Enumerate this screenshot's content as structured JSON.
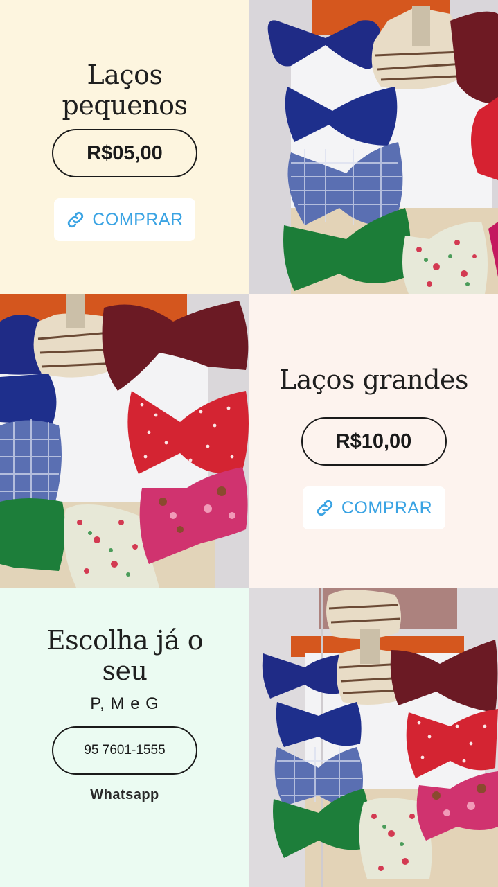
{
  "panels": {
    "small": {
      "title_line1": "Laços",
      "title_line2": "pequenos",
      "price": "R$05,00",
      "button": "COMPRAR",
      "bg": "#fdf5df"
    },
    "large": {
      "title": "Laços grandes",
      "price": "R$10,00",
      "button": "COMPRAR",
      "bg": "#fdf3ee"
    },
    "choose": {
      "title_line1": "Escolha já o",
      "title_line2": "seu",
      "sizes": "P, M e G",
      "phone": "95 7601-1555",
      "contact_label": "Whatsapp",
      "bg": "#ebfbf2"
    }
  },
  "colors": {
    "accent": "#3aa3e3",
    "text": "#1a1a1a"
  },
  "icons": {
    "buy": "link-icon"
  }
}
